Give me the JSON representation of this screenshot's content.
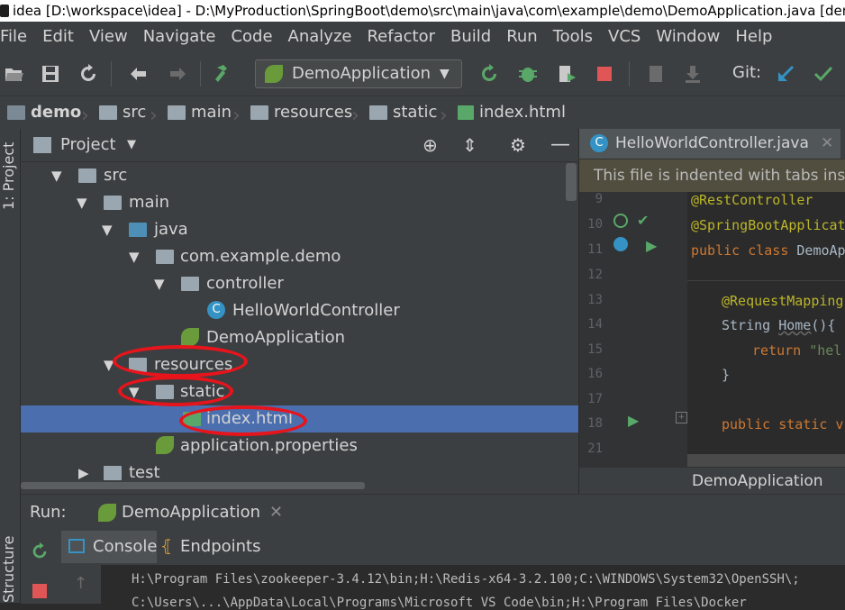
{
  "window": {
    "title": "idea [D:\\workspace\\idea] - D:\\MyProduction\\SpringBoot\\demo\\src\\main\\java\\com\\example\\demo\\DemoApplication.java [dem"
  },
  "menu": [
    "File",
    "Edit",
    "View",
    "Navigate",
    "Code",
    "Analyze",
    "Refactor",
    "Build",
    "Run",
    "Tools",
    "VCS",
    "Window",
    "Help"
  ],
  "toolbar": {
    "run_config": "DemoApplication",
    "git_label": "Git:"
  },
  "breadcrumb": [
    "demo",
    "src",
    "main",
    "resources",
    "static",
    "index.html"
  ],
  "left_strip": {
    "project_tab": "1: Project",
    "structure_tab": "Structure"
  },
  "project": {
    "title": "Project",
    "tree": [
      {
        "label": "src"
      },
      {
        "label": "main"
      },
      {
        "label": "java"
      },
      {
        "label": "com.example.demo"
      },
      {
        "label": "controller"
      },
      {
        "label": "HelloWorldController"
      },
      {
        "label": "DemoApplication"
      },
      {
        "label": "resources"
      },
      {
        "label": "static"
      },
      {
        "label": "index.html"
      },
      {
        "label": "application.properties"
      },
      {
        "label": "test"
      }
    ]
  },
  "editor": {
    "tab_label": "HelloWorldController.java",
    "banner": "This file is indented with tabs ins",
    "line_numbers": [
      "9",
      "10",
      "11",
      "12",
      "13",
      "14",
      "15",
      "16",
      "17",
      "18",
      "21"
    ],
    "code": {
      "l9": "@RestController",
      "l10": "@SpringBootApplicat",
      "l11_kw": "public class ",
      "l11_name": "DemoAp",
      "l13": "@RequestMapping",
      "l14_type": "String ",
      "l14_name": "Home",
      "l14_rest": "(){",
      "l15_kw": "return ",
      "l15_str": "\"hel",
      "l16": "}",
      "l18_kw": "public static v"
    },
    "footer": "DemoApplication"
  },
  "run": {
    "label": "Run:",
    "config": "DemoApplication",
    "tabs": [
      "Console",
      "Endpoints"
    ],
    "console_lines": [
      "H:\\Program Files\\zookeeper-3.4.12\\bin;H:\\Redis-x64-3.2.100;C:\\WINDOWS\\System32\\OpenSSH\\;",
      "C:\\Users\\...\\AppData\\Local\\Programs\\Microsoft VS Code\\bin;H:\\Program Files\\Docker"
    ]
  },
  "colors": {
    "selection": "#4b6eaf",
    "highlight_ellipse": "#e8141b",
    "run_green": "#59a869",
    "stop_red": "#e05555"
  }
}
